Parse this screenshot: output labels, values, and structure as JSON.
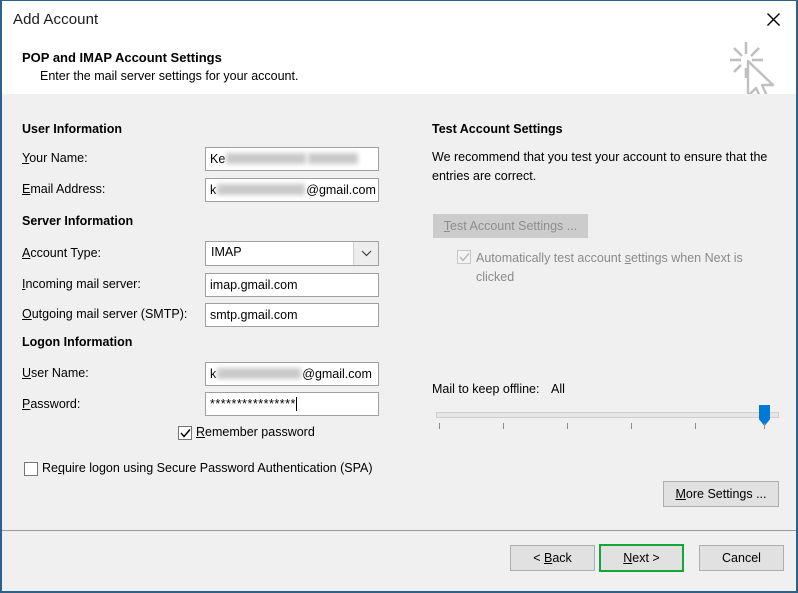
{
  "window": {
    "title": "Add Account",
    "close_icon": "close-icon",
    "watermark_icon": "cursor-sparkle-icon"
  },
  "header": {
    "title": "POP and IMAP Account Settings",
    "subtitle": "Enter the mail server settings for your account."
  },
  "sections": {
    "user_information": "User Information",
    "server_information": "Server Information",
    "logon_information": "Logon Information",
    "test_account_settings": "Test Account Settings"
  },
  "fields": {
    "your_name": {
      "label_prefix": "",
      "label_accel": "Y",
      "label_suffix": "our Name:",
      "value_visible": "Ke",
      "redacted": true
    },
    "email_address": {
      "label_accel": "E",
      "label_suffix": "mail Address:",
      "value_prefix": "k",
      "value_suffix": "@gmail.com",
      "redacted": true
    },
    "account_type": {
      "label_accel": "A",
      "label_suffix": "ccount Type:",
      "value": "IMAP",
      "arrow_icon": "chevron-down-icon"
    },
    "incoming_mail_server": {
      "label_accel": "I",
      "label_suffix": "ncoming mail server:",
      "value": "imap.gmail.com"
    },
    "outgoing_mail_server": {
      "label_accel": "O",
      "label_suffix": "utgoing mail server (SMTP):",
      "value": "smtp.gmail.com"
    },
    "user_name": {
      "label_accel": "U",
      "label_suffix": "ser Name:",
      "value_prefix": "k",
      "value_suffix": "@gmail.com",
      "redacted": true
    },
    "password": {
      "label_accel": "P",
      "label_suffix": "assword:",
      "value": "****************"
    }
  },
  "checkboxes": {
    "remember_password": {
      "accel": "R",
      "label_suffix": "emember password",
      "checked": true,
      "enabled": true
    },
    "require_spa": {
      "label_prefix": "Re",
      "accel": "q",
      "label_suffix": "uire logon using Secure Password Authentication (SPA)",
      "checked": false,
      "enabled": true
    },
    "auto_test": {
      "label_prefix": "Automatically test account ",
      "accel": "s",
      "label_suffix": "ettings when Next is clicked",
      "checked": true,
      "enabled": false
    }
  },
  "test_panel": {
    "description": "We recommend that you test your account to ensure that the entries are correct.",
    "button": {
      "accel": "T",
      "label_suffix": "est Account Settings ...",
      "enabled": false
    }
  },
  "offline_slider": {
    "label": "Mail to keep offline:",
    "value": "All",
    "ticks": 6,
    "position_percent": 100
  },
  "buttons": {
    "more_settings": {
      "accel": "M",
      "label_suffix": "ore Settings ..."
    },
    "back": {
      "label_prefix": "< ",
      "accel": "B",
      "label_suffix": "ack"
    },
    "next": {
      "accel": "N",
      "label_suffix": "ext >",
      "highlighted": true
    },
    "cancel": {
      "label": "Cancel"
    }
  },
  "colors": {
    "window_border": "#2e6188",
    "body_background": "#f0f0f0",
    "accent_slider": "#0078d7",
    "highlight_green": "#13a538",
    "disabled_text": "#8d8d8d"
  }
}
